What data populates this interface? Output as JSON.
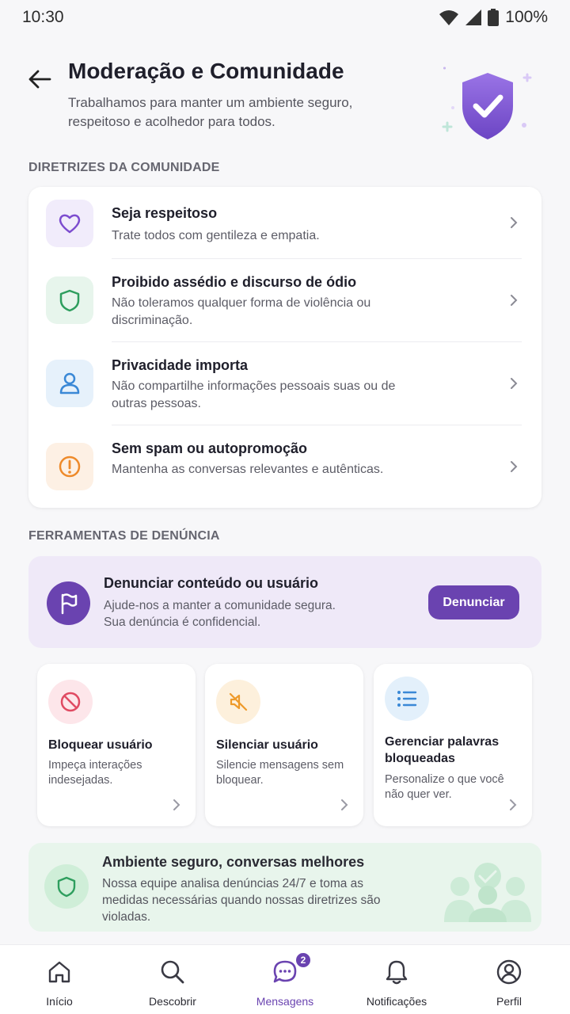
{
  "status_bar": {
    "time": "10:30",
    "battery": "100%"
  },
  "header": {
    "title": "Moderação e Comunidade",
    "subtitle": "Trabalhamos para manter um ambiente seguro, respeitoso e acolhedor para todos."
  },
  "guidelines": {
    "section_label": "DIRETRIZES DA COMUNIDADE",
    "items": [
      {
        "title": "Seja respeitoso",
        "desc": "Trate todos com gentileza e empatia.",
        "icon": "heart-icon",
        "color": "#7c4ccf"
      },
      {
        "title": "Proibido assédio e discurso de ódio",
        "desc": "Não toleramos qualquer forma de violência ou discriminação.",
        "icon": "shield-icon",
        "color": "#2e9e5e"
      },
      {
        "title": "Privacidade importa",
        "desc": "Não compartilhe informações pessoais suas ou de outras pessoas.",
        "icon": "user-icon",
        "color": "#3a88d6"
      },
      {
        "title": "Sem spam ou autopromoção",
        "desc": "Mantenha as conversas relevantes e autênticas.",
        "icon": "alert-icon",
        "color": "#ee8a2a"
      }
    ]
  },
  "tools": {
    "section_label": "FERRAMENTAS DE DENÚNCIA",
    "report": {
      "title": "Denunciar conteúdo ou usuário",
      "desc": "Ajude-nos a manter a comunidade segura. Sua denúncia é confidencial.",
      "button": "Denunciar"
    },
    "cards": [
      {
        "title": "Bloquear usuário",
        "desc": "Impeça interações indesejadas.",
        "icon": "block-icon"
      },
      {
        "title": "Silenciar usuário",
        "desc": "Silencie mensagens sem bloquear.",
        "icon": "mute-icon"
      },
      {
        "title": "Gerenciar palavras bloqueadas",
        "desc": "Personalize o que você não quer ver.",
        "icon": "list-icon"
      }
    ]
  },
  "safe_banner": {
    "title": "Ambiente seguro, conversas melhores",
    "desc": "Nossa equipe analisa denúncias 24/7 e toma as medidas necessárias quando nossas diretrizes são violadas."
  },
  "nav": {
    "items": [
      {
        "label": "Início",
        "icon": "home-icon"
      },
      {
        "label": "Descobrir",
        "icon": "search-icon"
      },
      {
        "label": "Mensagens",
        "icon": "chat-icon",
        "badge": "2",
        "active": true
      },
      {
        "label": "Notificações",
        "icon": "bell-icon"
      },
      {
        "label": "Perfil",
        "icon": "profile-icon"
      }
    ]
  },
  "colors": {
    "accent": "#6a43b0",
    "background": "#f7f7f9"
  }
}
